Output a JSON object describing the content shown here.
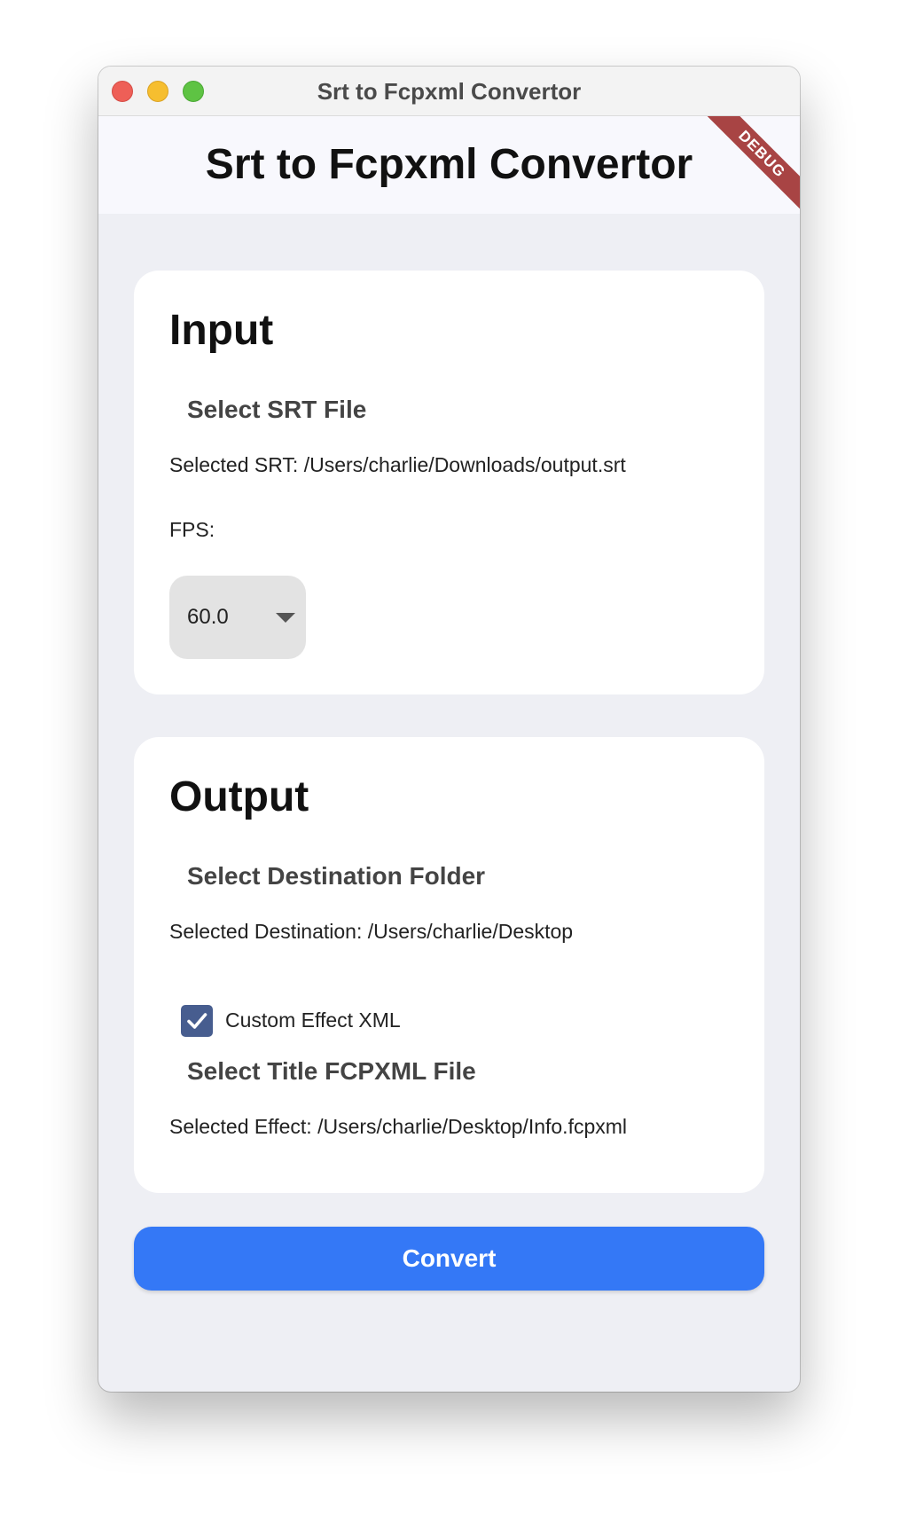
{
  "window": {
    "title": "Srt to Fcpxml Convertor"
  },
  "appbar": {
    "title": "Srt to Fcpxml Convertor",
    "debug_label": "DEBUG"
  },
  "input": {
    "heading": "Input",
    "select_srt_label": "Select SRT File",
    "selected_srt_text": "Selected SRT: /Users/charlie/Downloads/output.srt",
    "fps_label": "FPS:",
    "fps_value": "60.0"
  },
  "output": {
    "heading": "Output",
    "select_destination_label": "Select Destination Folder",
    "selected_destination_text": "Selected Destination: /Users/charlie/Desktop",
    "custom_effect_label": "Custom Effect XML",
    "custom_effect_checked": true,
    "select_title_label": "Select Title FCPXML File",
    "selected_effect_text": "Selected Effect: /Users/charlie/Desktop/Info.fcpxml"
  },
  "actions": {
    "convert_label": "Convert"
  },
  "colors": {
    "accent": "#3478f6",
    "checkbox": "#475d8f",
    "debug_banner": "#a84444",
    "background": "#eeeff4"
  }
}
